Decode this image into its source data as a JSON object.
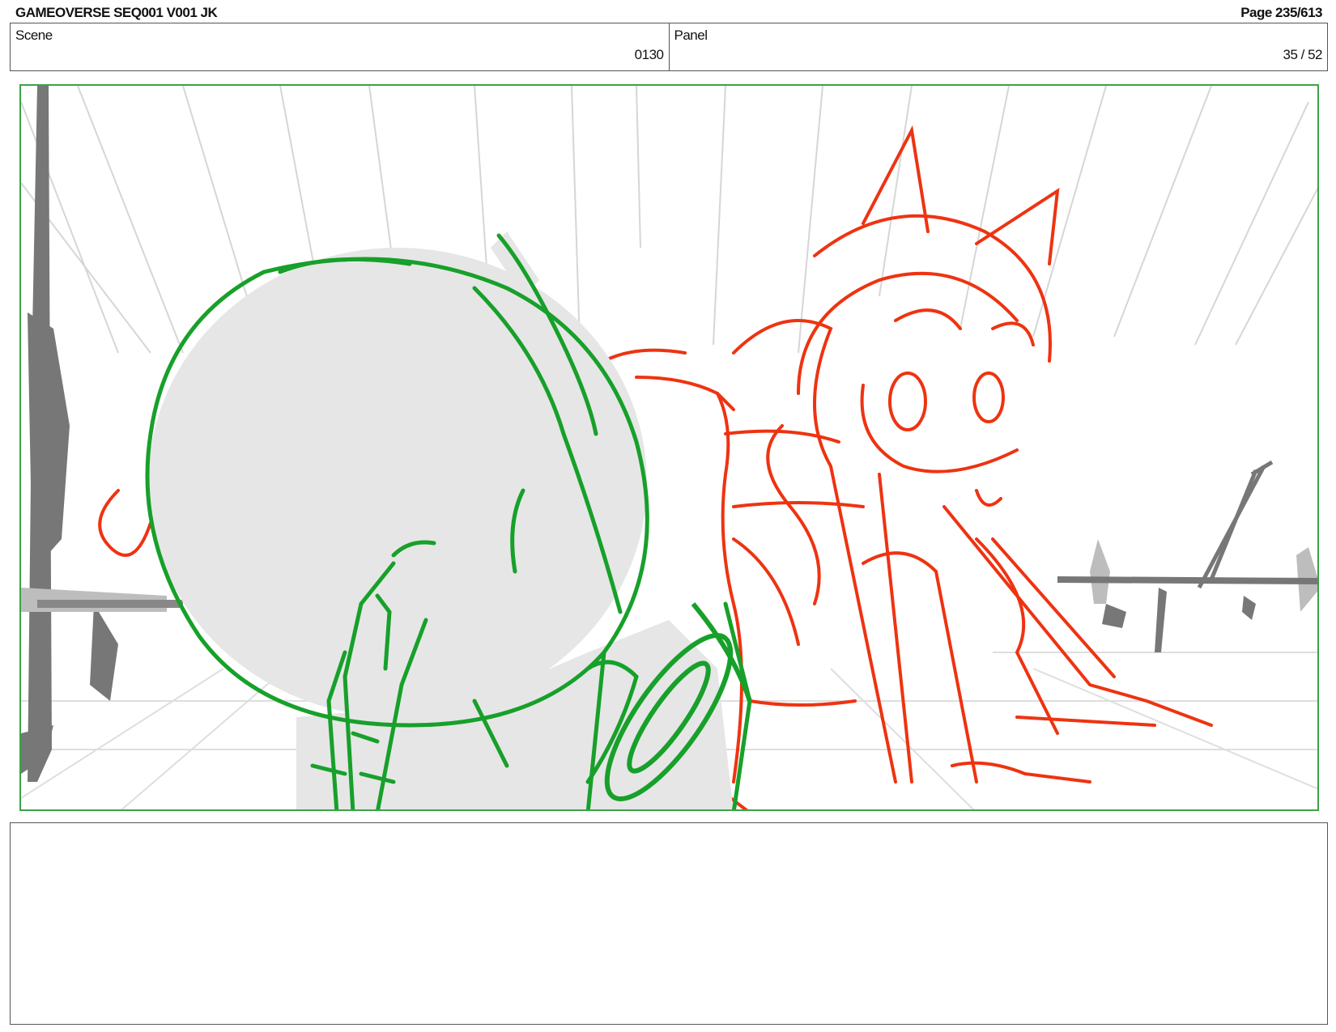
{
  "header": {
    "title": "GAMEOVERSE SEQ001 V001 JK",
    "page": "Page 235/613"
  },
  "scene": {
    "label": "Scene",
    "value": "0130"
  },
  "panel": {
    "label": "Panel",
    "value": "35 / 52"
  },
  "colors": {
    "frame_border": "#3aa346",
    "robot_line": "#17a02a",
    "character_line": "#ee3311",
    "background_grey": "#777777",
    "fill_grey": "#e6e6e6"
  },
  "notes": {
    "text": ""
  }
}
